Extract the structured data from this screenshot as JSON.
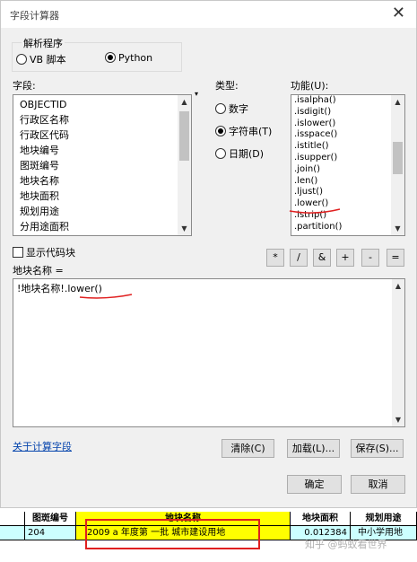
{
  "window": {
    "title": "字段计算器",
    "close_icon": "close-icon"
  },
  "parser": {
    "legend": "解析程序",
    "options": [
      {
        "label": "VB 脚本",
        "selected": false
      },
      {
        "label": "Python",
        "selected": true
      }
    ]
  },
  "fields": {
    "label": "字段:",
    "items": [
      "OBJECTID",
      "行政区名称",
      "行政区代码",
      "地块编号",
      "图斑编号",
      "地块名称",
      "地块面积",
      "规划用途",
      "分用途面积"
    ]
  },
  "types": {
    "label": "类型:",
    "options": [
      {
        "label": "数字",
        "selected": false
      },
      {
        "label": "字符串(T)",
        "selected": true
      },
      {
        "label": "日期(D)",
        "selected": false
      }
    ]
  },
  "functions": {
    "label": "功能(U):",
    "items": [
      ".isalpha()",
      ".isdigit()",
      ".islower()",
      ".isspace()",
      ".istitle()",
      ".isupper()",
      ".join()",
      ".len()",
      ".ljust()",
      ".lower()",
      ".lstrip()",
      ".partition()"
    ]
  },
  "show_codeblock": {
    "label": "显示代码块",
    "checked": false
  },
  "operators": [
    "*",
    "/",
    "&",
    "+",
    "-",
    "="
  ],
  "expression": {
    "label": "地块名称 =",
    "value": "!地块名称!.lower()"
  },
  "link": "关于计算字段",
  "buttons": {
    "clear": "清除(C)",
    "load": "加载(L)...",
    "save": "保存(S)...",
    "ok": "确定",
    "cancel": "取消"
  },
  "sheet": {
    "headers": [
      "图斑编号",
      "地块名称",
      "地块面积",
      "规划用途"
    ],
    "row": [
      "204",
      "2009 a 年度第 一批  城市建设用地",
      "0.012384",
      "中小学用地"
    ]
  },
  "watermark": "知乎 @蚂蚁看世界",
  "colors": {
    "annotation": "#e02020",
    "highlight": "#ffff00",
    "row": "#ccffff",
    "link": "#0645ad"
  }
}
